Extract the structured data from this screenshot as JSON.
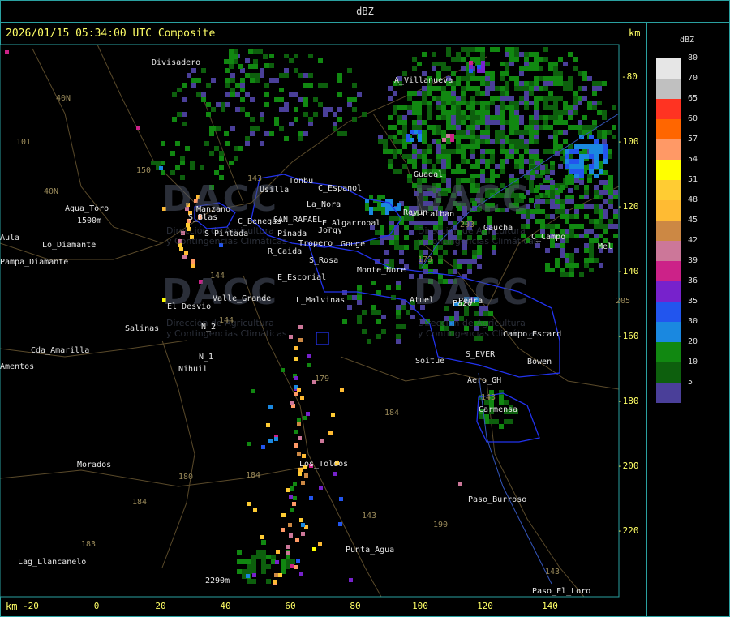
{
  "header": {
    "title": "dBZ"
  },
  "map": {
    "timestamp": "2026/01/15 05:34:00 UTC Composite",
    "km_label_top": "km",
    "km_label_bottom": "km",
    "y_ticks": [
      "-80",
      "-100",
      "-120",
      "-140",
      "-160",
      "-180",
      "-200",
      "-220"
    ],
    "x_ticks": [
      "-20",
      "0",
      "20",
      "40",
      "60",
      "80",
      "100",
      "120",
      "140"
    ],
    "places": [
      "Divisadero",
      "A_Villanueva",
      "Tonbu",
      "Usilla",
      "C_Espanol",
      "La_Nora",
      "Guadal",
      "Vistalban",
      "Gaucha",
      "Agua_Toro",
      "Manzano",
      "S_Blas",
      "C_Benegas",
      "SAN_RAFAEL",
      "E_Algarrobal",
      "Pinada",
      "Tropero",
      "Jorgy",
      "Gouge",
      "S_Pintada",
      "R_Caida",
      "S_Rosa",
      "Monte_Nore",
      "C_Campo",
      "E_Escorial",
      "Valle_Grande",
      "L_Malvinas",
      "Atuel",
      "Pedra",
      "El_Desvio",
      "Salinas",
      "N_2",
      "N_1",
      "Nihuil",
      "Cda_Amarilla",
      "Amentos",
      "Campo_Escard",
      "Bowen",
      "S_EVER",
      "Soitue",
      "Aero_GH",
      "Carmensa",
      "Los_Toldos",
      "Morados",
      "Paso_Burroso",
      "Punta_Agua",
      "Lag_Llancanelo",
      "Paso_El_Loro",
      "Pampa_Diamante",
      "Aula",
      "Mel",
      "Reyun",
      "2290m",
      "1500m",
      "Lo_Diamante",
      "Pazo"
    ],
    "route_numbers": [
      "101",
      "40N",
      "40N",
      "150",
      "143",
      "144",
      "144",
      "173",
      "203",
      "143",
      "205",
      "179",
      "184",
      "184",
      "180",
      "184",
      "183",
      "190",
      "143",
      "143"
    ],
    "watermark": {
      "brand": "DACC",
      "line1": "Dirección de Agricultura",
      "line2": "y Contingencias Climáticas"
    }
  },
  "legend": {
    "title": "dBZ",
    "scale": [
      {
        "value": "80",
        "color": "#e6e6e6"
      },
      {
        "value": "70",
        "color": "#c0c0c0"
      },
      {
        "value": "65",
        "color": "#ff3322"
      },
      {
        "value": "60",
        "color": "#ff6600"
      },
      {
        "value": "57",
        "color": "#ff9966"
      },
      {
        "value": "54",
        "color": "#ffff00"
      },
      {
        "value": "51",
        "color": "#ffcc33"
      },
      {
        "value": "48",
        "color": "#ffbb33"
      },
      {
        "value": "45",
        "color": "#cc8844"
      },
      {
        "value": "42",
        "color": "#cc7799"
      },
      {
        "value": "39",
        "color": "#cc2288"
      },
      {
        "value": "36",
        "color": "#7722cc"
      },
      {
        "value": "35",
        "color": "#2255ee"
      },
      {
        "value": "30",
        "color": "#1a88e0"
      },
      {
        "value": "20",
        "color": "#118811"
      },
      {
        "value": "10",
        "color": "#0d5f0d"
      },
      {
        "value": "5",
        "color": "#4a3f99"
      }
    ]
  }
}
